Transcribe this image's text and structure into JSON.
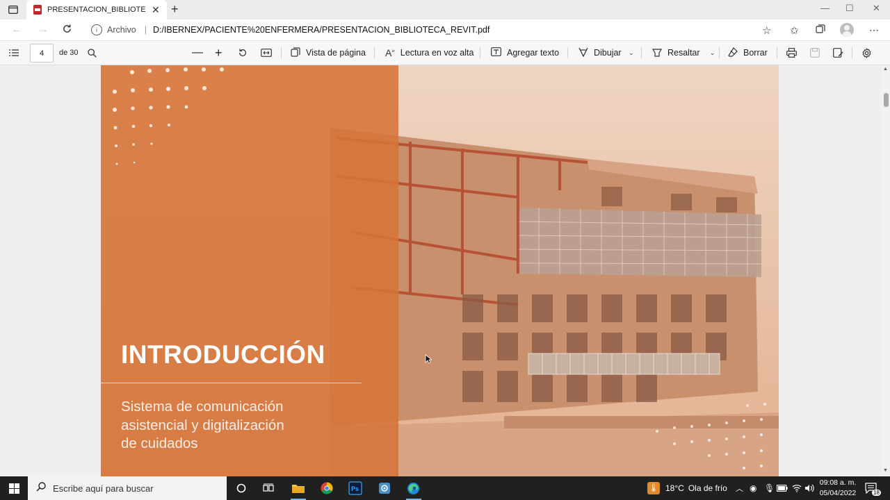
{
  "browser": {
    "tab_title": "PRESENTACION_BIBLIOTECA_REVIT.pdf",
    "tab_close": "✕",
    "new_tab": "+",
    "scheme_label": "Archivo",
    "url": "D:/IBERNEX/PACIENTE%20ENFERMERA/PRESENTACION_BIBLIOTECA_REVIT.pdf"
  },
  "pdf_toolbar": {
    "page_number": "4",
    "page_total": "de 30",
    "page_view": "Vista de página",
    "read_aloud": "Lectura en voz alta",
    "add_text": "Agregar texto",
    "draw": "Dibujar",
    "highlight": "Resaltar",
    "erase": "Borrar"
  },
  "slide": {
    "title": "INTRODUCCIÓN",
    "subtitle_lines": [
      "Sistema de comunicación",
      "asistencial y digitalización",
      "de cuidados"
    ],
    "panel_color": "#d6743a"
  },
  "taskbar": {
    "search_placeholder": "Escribe aquí para buscar",
    "weather_temp": "18°C",
    "weather_text": "Ola de frío",
    "time": "09:08 a. m.",
    "date": "05/04/2022",
    "notifications": "18"
  }
}
